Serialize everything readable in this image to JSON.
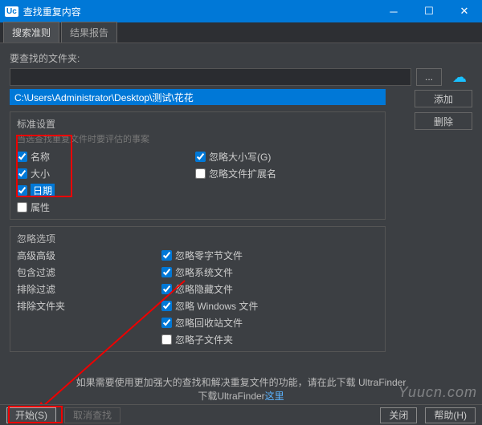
{
  "window": {
    "title": "查找重复内容"
  },
  "tabs": {
    "active": "搜索准则",
    "inactive": "结果报告"
  },
  "folderLabel": "要查找的文件夹:",
  "browseBtn": "...",
  "selectedPath": "C:\\Users\\Administrator\\Desktop\\测试\\花花",
  "buttons": {
    "add": "添加",
    "remove": "删除"
  },
  "criteria": {
    "title": "标准设置",
    "hint": "当选查找重复文件时要评估的事案",
    "items": [
      {
        "label": "名称",
        "checked": true,
        "selected": false
      },
      {
        "label": "大小",
        "checked": true,
        "selected": false
      },
      {
        "label": "日期",
        "checked": true,
        "selected": true
      },
      {
        "label": "属性",
        "checked": false,
        "selected": false
      }
    ],
    "rightItems": [
      {
        "label": "忽略大小写(G)",
        "checked": true
      },
      {
        "label": "忽略文件扩展名",
        "checked": false
      }
    ]
  },
  "ignore": {
    "title": "忽略选项",
    "leftItems": [
      {
        "label": "高级高级"
      },
      {
        "label": "包含过滤"
      },
      {
        "label": "排除过滤"
      },
      {
        "label": "排除文件夹"
      }
    ],
    "rightItems": [
      {
        "label": "忽略零字节文件",
        "checked": true
      },
      {
        "label": "忽略系统文件",
        "checked": true
      },
      {
        "label": "忽略隐藏文件",
        "checked": true
      },
      {
        "label": "忽略 Windows 文件",
        "checked": true
      },
      {
        "label": "忽略回收站文件",
        "checked": true
      },
      {
        "label": "忽略子文件夹",
        "checked": false
      }
    ]
  },
  "footer": {
    "msgLine1": "如果需要使用更加强大的查找和解决重复文件的功能，请在此下载 UltraFinder",
    "msgLine2Prefix": "下载UltraFinder",
    "msgLine2Link": "这里"
  },
  "bottom": {
    "start": "开始(S)",
    "cancel": "取消查找",
    "close": "关闭",
    "help": "帮助(H)"
  },
  "watermark": "Yuucn.com"
}
